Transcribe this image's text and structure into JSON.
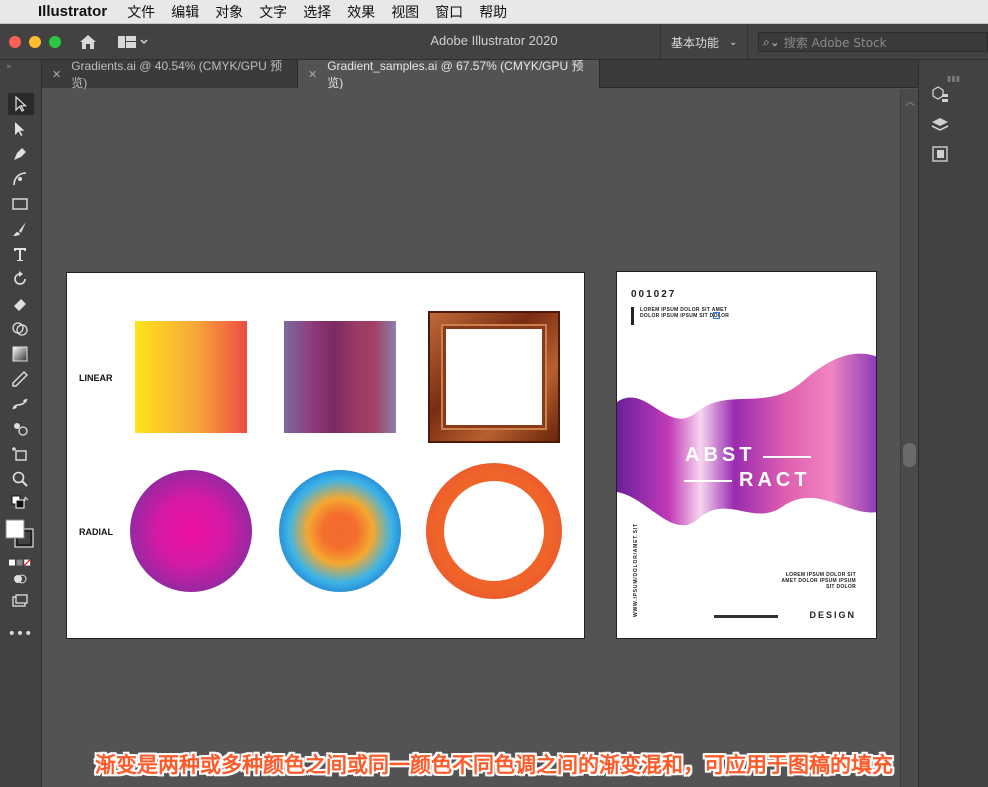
{
  "menubar": {
    "app_name": "Illustrator",
    "items": [
      "文件",
      "编辑",
      "对象",
      "文字",
      "选择",
      "效果",
      "视图",
      "窗口",
      "帮助"
    ]
  },
  "titlebar": {
    "title": "Adobe Illustrator 2020",
    "workspace": "基本功能",
    "stock_placeholder": "搜索 Adobe Stock"
  },
  "tabs": [
    {
      "label": "Gradients.ai @ 40.54% (CMYK/GPU 预览)",
      "active": false
    },
    {
      "label": "Gradient_samples.ai @ 67.57% (CMYK/GPU 预览)",
      "active": true
    }
  ],
  "artboard1": {
    "linear_label": "LINEAR",
    "radial_label": "RADIAL"
  },
  "artboard2": {
    "number": "001027",
    "lorem_top": "LOREM IPSUM DOLOR SIT AMET DOLOR IPSUM IPSUM SIT DOLOR",
    "abst": "ABST",
    "ract": "RACT",
    "vertical_text": "WWW.IPSUM/DOLOR/AMET.SIT",
    "lorem_bottom": "LOREM IPSUM DOLOR SIT AMET DOLOR IPSUM IPSUM SIT DOLOR",
    "design": "DESIGN"
  },
  "caption": "渐变是两种或多种颜色之间或同一颜色不同色调之间的渐变混和，可应用于图稿的填充",
  "colors": {
    "caption": "#ff5a2a",
    "canvas": "#535353",
    "panel": "#424242"
  }
}
